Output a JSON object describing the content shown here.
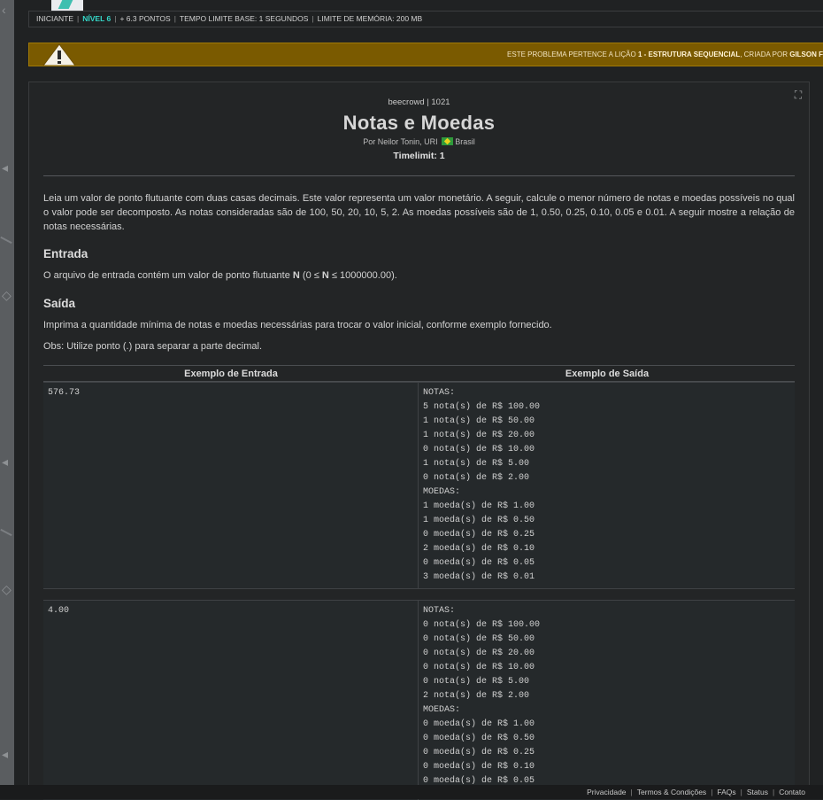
{
  "topbar": {
    "category": "INICIANTE",
    "level": "NÍVEL 6",
    "points": "+ 6.3 PONTOS",
    "time_limit": "TEMPO LIMITE BASE: 1 SEGUNDOS",
    "memory_limit": "LIMITE DE MEMÓRIA: 200 MB"
  },
  "warning": {
    "prefix": "ESTE PROBLEMA PERTENCE A LIÇÃO ",
    "lesson": "1 - ESTRUTURA SEQUENCIAL",
    "middle": ", CRIADA POR ",
    "creator": "GILSON F"
  },
  "problem": {
    "breadcrumb": "beecrowd | 1021",
    "title": "Notas e Moedas",
    "author_prefix": "Por Neilor Tonin, URI",
    "country": "Brasil",
    "timelimit": "Timelimit: 1",
    "description": "Leia um valor de ponto flutuante com duas casas decimais. Este valor representa um valor monetário. A seguir, calcule o menor número de notas e moedas possíveis no qual o valor pode ser decomposto. As notas consideradas são de 100, 50, 20, 10, 5, 2. As moedas possíveis são de 1, 0.50, 0.25, 0.10, 0.05 e 0.01. A seguir mostre a relação de notas necessárias.",
    "input_heading": "Entrada",
    "input_text_pre": "O arquivo de entrada contém um valor de ponto flutuante ",
    "input_var": "N",
    "input_text_mid": " (0 ≤ ",
    "input_var2": "N",
    "input_text_post": " ≤ 1000000.00).",
    "output_heading": "Saída",
    "output_text": "Imprima a quantidade mínima de notas e moedas necessárias para trocar o valor inicial, conforme exemplo fornecido.",
    "obs_text": "Obs: Utilize ponto (.) para separar a parte decimal."
  },
  "samples": {
    "input_header": "Exemplo de Entrada",
    "output_header": "Exemplo de Saída",
    "cases": [
      {
        "input": "576.73",
        "output": "NOTAS:\n5 nota(s) de R$ 100.00\n1 nota(s) de R$ 50.00\n1 nota(s) de R$ 20.00\n0 nota(s) de R$ 10.00\n1 nota(s) de R$ 5.00\n0 nota(s) de R$ 2.00\nMOEDAS:\n1 moeda(s) de R$ 1.00\n1 moeda(s) de R$ 0.50\n0 moeda(s) de R$ 0.25\n2 moeda(s) de R$ 0.10\n0 moeda(s) de R$ 0.05\n3 moeda(s) de R$ 0.01"
      },
      {
        "input": "4.00",
        "output": "NOTAS:\n0 nota(s) de R$ 100.00\n0 nota(s) de R$ 50.00\n0 nota(s) de R$ 20.00\n0 nota(s) de R$ 10.00\n0 nota(s) de R$ 5.00\n2 nota(s) de R$ 2.00\nMOEDAS:\n0 moeda(s) de R$ 1.00\n0 moeda(s) de R$ 0.50\n0 moeda(s) de R$ 0.25\n0 moeda(s) de R$ 0.10\n0 moeda(s) de R$ 0.05"
      }
    ]
  },
  "footer": {
    "privacy": "Privacidade",
    "terms": "Termos & Condições",
    "faqs": "FAQs",
    "status": "Status",
    "contact": "Contato"
  },
  "icons": {
    "warning": "warning-triangle-icon",
    "expand": "expand-icon",
    "flag": "brazil-flag-icon"
  },
  "colors": {
    "level_accent": "#35d7c8",
    "warning_bg": "#7a5a00",
    "background": "#202223"
  }
}
